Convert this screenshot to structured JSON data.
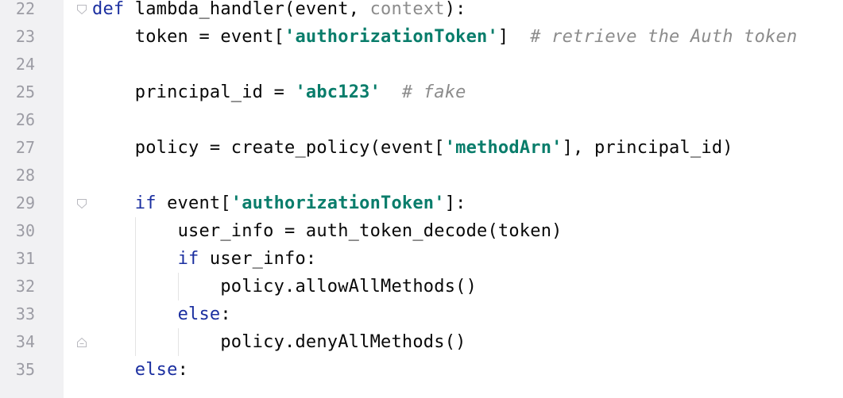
{
  "editor": {
    "lines": [
      {
        "num": "22",
        "fold": "open",
        "indent": 0,
        "tokens": [
          {
            "t": "def",
            "c": "kw"
          },
          {
            "t": " lambda_handler(event, "
          },
          {
            "t": "context",
            "c": "param"
          },
          {
            "t": "):"
          }
        ]
      },
      {
        "num": "23",
        "fold": "",
        "indent": 1,
        "tokens": [
          {
            "t": "token = event["
          },
          {
            "t": "'authorizationToken'",
            "c": "str"
          },
          {
            "t": "]  "
          },
          {
            "t": "# retrieve the Auth token",
            "c": "cm"
          }
        ]
      },
      {
        "num": "24",
        "fold": "",
        "indent": 0,
        "tokens": []
      },
      {
        "num": "25",
        "fold": "",
        "indent": 1,
        "tokens": [
          {
            "t": "principal_id = "
          },
          {
            "t": "'abc123'",
            "c": "str"
          },
          {
            "t": "  "
          },
          {
            "t": "# fake",
            "c": "cm"
          }
        ]
      },
      {
        "num": "26",
        "fold": "",
        "indent": 0,
        "tokens": []
      },
      {
        "num": "27",
        "fold": "",
        "indent": 1,
        "tokens": [
          {
            "t": "policy = create_policy(event["
          },
          {
            "t": "'methodArn'",
            "c": "str"
          },
          {
            "t": "], principal_id)"
          }
        ]
      },
      {
        "num": "28",
        "fold": "",
        "indent": 0,
        "tokens": []
      },
      {
        "num": "29",
        "fold": "open",
        "indent": 1,
        "tokens": [
          {
            "t": "if",
            "c": "kw"
          },
          {
            "t": " event["
          },
          {
            "t": "'authorizationToken'",
            "c": "str"
          },
          {
            "t": "]:"
          }
        ]
      },
      {
        "num": "30",
        "fold": "",
        "indent": 2,
        "tokens": [
          {
            "t": "user_info = auth_token_decode(token)"
          }
        ]
      },
      {
        "num": "31",
        "fold": "",
        "indent": 2,
        "tokens": [
          {
            "t": "if",
            "c": "kw"
          },
          {
            "t": " user_info:"
          }
        ]
      },
      {
        "num": "32",
        "fold": "",
        "indent": 3,
        "tokens": [
          {
            "t": "policy.allowAllMethods()"
          }
        ]
      },
      {
        "num": "33",
        "fold": "",
        "indent": 2,
        "tokens": [
          {
            "t": "else",
            "c": "kw"
          },
          {
            "t": ":"
          }
        ]
      },
      {
        "num": "34",
        "fold": "close",
        "indent": 3,
        "tokens": [
          {
            "t": "policy.denyAllMethods()"
          }
        ]
      },
      {
        "num": "35",
        "fold": "",
        "indent": 1,
        "tokens": [
          {
            "t": "else",
            "c": "kw"
          },
          {
            "t": ":"
          }
        ]
      }
    ]
  },
  "colors": {
    "keyword": "#1b2fa0",
    "string": "#097d6b",
    "comment": "#8c8c8c",
    "line_number": "#9c9ca4",
    "gutter_background": "#f1f1f3"
  }
}
